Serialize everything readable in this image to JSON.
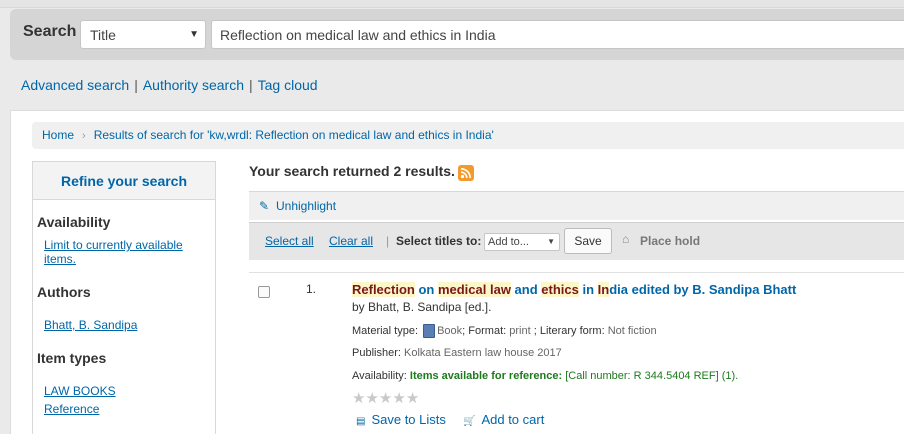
{
  "search": {
    "label": "Search",
    "index_selected": "Title",
    "query": "Reflection on medical law and ethics in India"
  },
  "more_searches": [
    "Advanced search",
    "Authority search",
    "Tag cloud"
  ],
  "breadcrumb": {
    "home": "Home",
    "current": "Results of search for 'kw,wrdl: Reflection on medical law and ethics in India'"
  },
  "refine": {
    "title": "Refine your search",
    "availability": {
      "heading": "Availability",
      "link": "Limit to currently available items."
    },
    "authors": {
      "heading": "Authors",
      "items": [
        "Bhatt, B. Sandipa"
      ]
    },
    "item_types": {
      "heading": "Item types",
      "items": [
        "LAW BOOKS",
        "Reference"
      ]
    }
  },
  "results": {
    "count_text": "Your search returned 2 results.",
    "unhighlight": "Unhighlight",
    "select_all": "Select all",
    "clear_all": "Clear all",
    "select_titles_label": "Select titles to:",
    "add_to": "Add to...",
    "save": "Save",
    "place_hold": "Place hold",
    "items": [
      {
        "number": "1.",
        "title": "Reflection on medical law and ethics in India edited by B. Sandipa Bhatt",
        "author": "by Bhatt, B. Sandipa [ed.].",
        "material_type_label": "Material type:",
        "material_type": "Book",
        "format_label": "Format:",
        "format": "print",
        "literary_form_label": "Literary form:",
        "literary_form": "Not fiction",
        "publisher_label": "Publisher:",
        "publisher": "Kolkata Eastern law house 2017",
        "availability_label": "Availability:",
        "availability": "Items available for reference:",
        "call_number": "[Call number: R 344.5404 REF] (1).",
        "rating_stars": 0,
        "save_to_lists": "Save to Lists",
        "add_to_cart": "Add to cart"
      }
    ]
  },
  "colors": {
    "link": "#0066a8",
    "available": "#1d7a1d",
    "highlight": "#fcf6c8"
  }
}
